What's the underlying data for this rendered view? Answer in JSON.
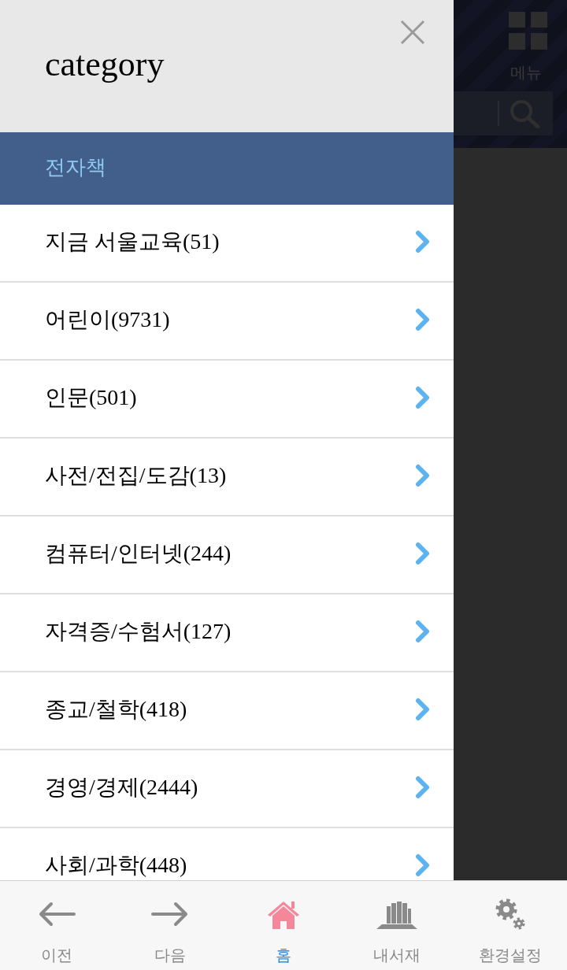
{
  "background_page": {
    "menu_label": "메뉴"
  },
  "drawer": {
    "title": "category",
    "section": "전자책",
    "items": [
      {
        "label": "지금 서울교육(51)"
      },
      {
        "label": "어린이(9731)"
      },
      {
        "label": "인문(501)"
      },
      {
        "label": "사전/전집/도감(13)"
      },
      {
        "label": "컴퓨터/인터넷(244)"
      },
      {
        "label": "자격증/수험서(127)"
      },
      {
        "label": "종교/철학(418)"
      },
      {
        "label": "경영/경제(2444)"
      },
      {
        "label": "사회/과학(448)"
      }
    ]
  },
  "bottom_nav": [
    {
      "kind": "back",
      "label": "이전",
      "selected": false
    },
    {
      "kind": "forward",
      "label": "다음",
      "selected": false
    },
    {
      "kind": "home",
      "label": "홈",
      "selected": true
    },
    {
      "kind": "bookshelf",
      "label": "내서재",
      "selected": false
    },
    {
      "kind": "settings",
      "label": "환경설정",
      "selected": false
    }
  ]
}
